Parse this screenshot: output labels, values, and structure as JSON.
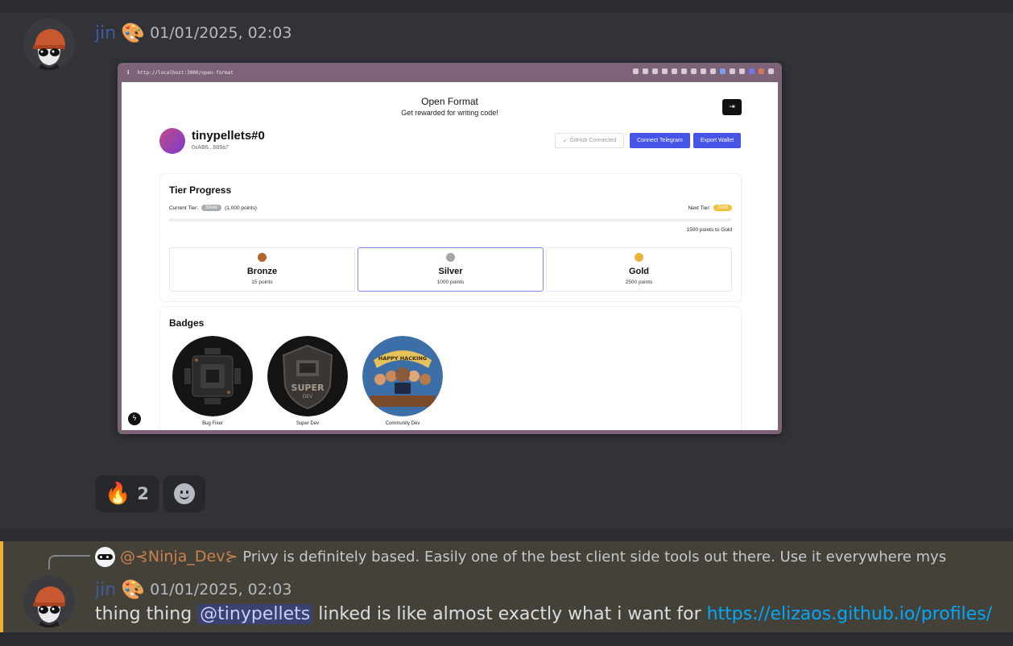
{
  "message1": {
    "author": "jin",
    "author_emoji": "🎨",
    "timestamp": "01/01/2025, 02:03"
  },
  "screenshot": {
    "url": "http://localhost:3000/open-format",
    "app_title": "Open Format",
    "app_subtitle": "Get rewarded for writing code!",
    "logout_icon": "⇥",
    "profile": {
      "name": "tinypellets#0",
      "wallet": "0xAB6...689a7"
    },
    "buttons": {
      "github": "GitHub Connected",
      "github_check": "✓",
      "telegram": "Connect Telegram",
      "export": "Export Wallet"
    },
    "tier_progress": {
      "title": "Tier Progress",
      "current_label": "Current Tier:",
      "current_tier": "Silver",
      "current_points": "(1,000 points)",
      "next_label": "Next Tier:",
      "next_tier": "Gold",
      "progress_fraction": 0.0,
      "to_next": "1500 points to Gold",
      "tiers": [
        {
          "name": "Bronze",
          "points": "15 points",
          "color": "#b5652b"
        },
        {
          "name": "Silver",
          "points": "1000 points",
          "color": "#a3a6ad"
        },
        {
          "name": "Gold",
          "points": "2500 points",
          "color": "#e9b43d"
        }
      ],
      "active_tier": "Silver"
    },
    "badges": {
      "title": "Badges",
      "items": [
        {
          "label": "Bug Fixer"
        },
        {
          "label": "Super Dev",
          "art_text_1": "SUPER",
          "art_text_2": "DEV"
        },
        {
          "label": "Community Dev",
          "art_text": "HAPPY HACKING"
        }
      ]
    },
    "bolt_icon": "ϟ"
  },
  "reactions": [
    {
      "emoji": "🔥",
      "count": "2"
    },
    {
      "icon": "add-reaction-icon"
    }
  ],
  "message2": {
    "reply": {
      "author": "@⊰Ninja_Dev⊱",
      "text": "Privy is definitely based. Easily one of the best client side tools out there.  Use it everywhere mys"
    },
    "author": "jin",
    "author_emoji": "🎨",
    "timestamp": "01/01/2025, 02:03",
    "body_before": "thing thing ",
    "mention": "@tinypellets",
    "body_middle": " linked is like almost exactly what i want for ",
    "link": "https://elizaos.github.io/profiles/"
  },
  "colors": {
    "author": "#3e5c9e",
    "mention_border": "#f0b232",
    "link": "#00a8fc",
    "accent_button": "#4655e6"
  }
}
